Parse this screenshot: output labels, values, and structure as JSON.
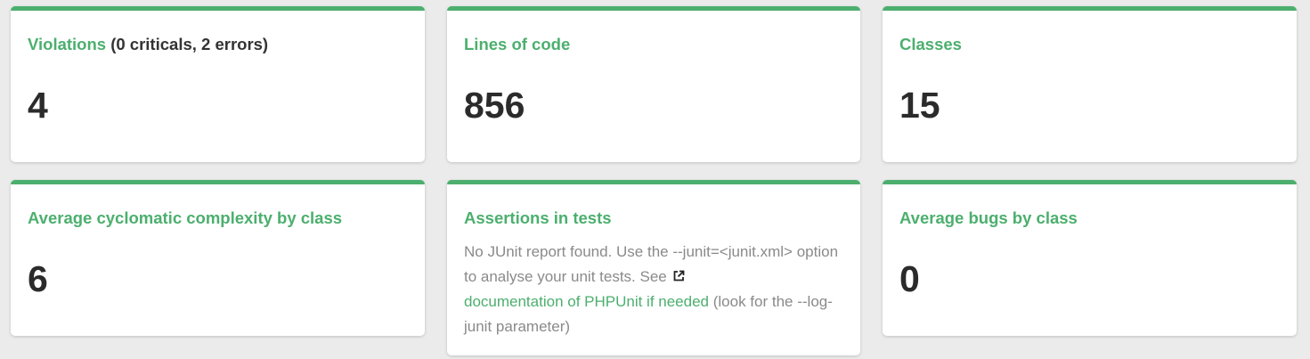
{
  "cards": {
    "violations": {
      "title": "Violations",
      "detail": "(0 criticals, 2 errors)",
      "value": "4"
    },
    "lines_of_code": {
      "title": "Lines of code",
      "value": "856"
    },
    "classes": {
      "title": "Classes",
      "value": "15"
    },
    "avg_complexity": {
      "title": "Average cyclomatic complexity by class",
      "value": "6"
    },
    "assertions": {
      "title": "Assertions in tests",
      "text_before": "No JUnit report found. Use the --junit=<junit.xml> option to analyse your unit tests. See ",
      "link_text": "documentation of PHPUnit if needed",
      "text_after": " (look for the --log-junit parameter)",
      "link_icon": "external-link-icon"
    },
    "avg_bugs": {
      "title": "Average bugs by class",
      "value": "0"
    }
  },
  "colors": {
    "accent": "#4caf6e",
    "value_text": "#2b2b2b",
    "muted_text": "#8a8a8a",
    "background": "#ebebeb"
  }
}
